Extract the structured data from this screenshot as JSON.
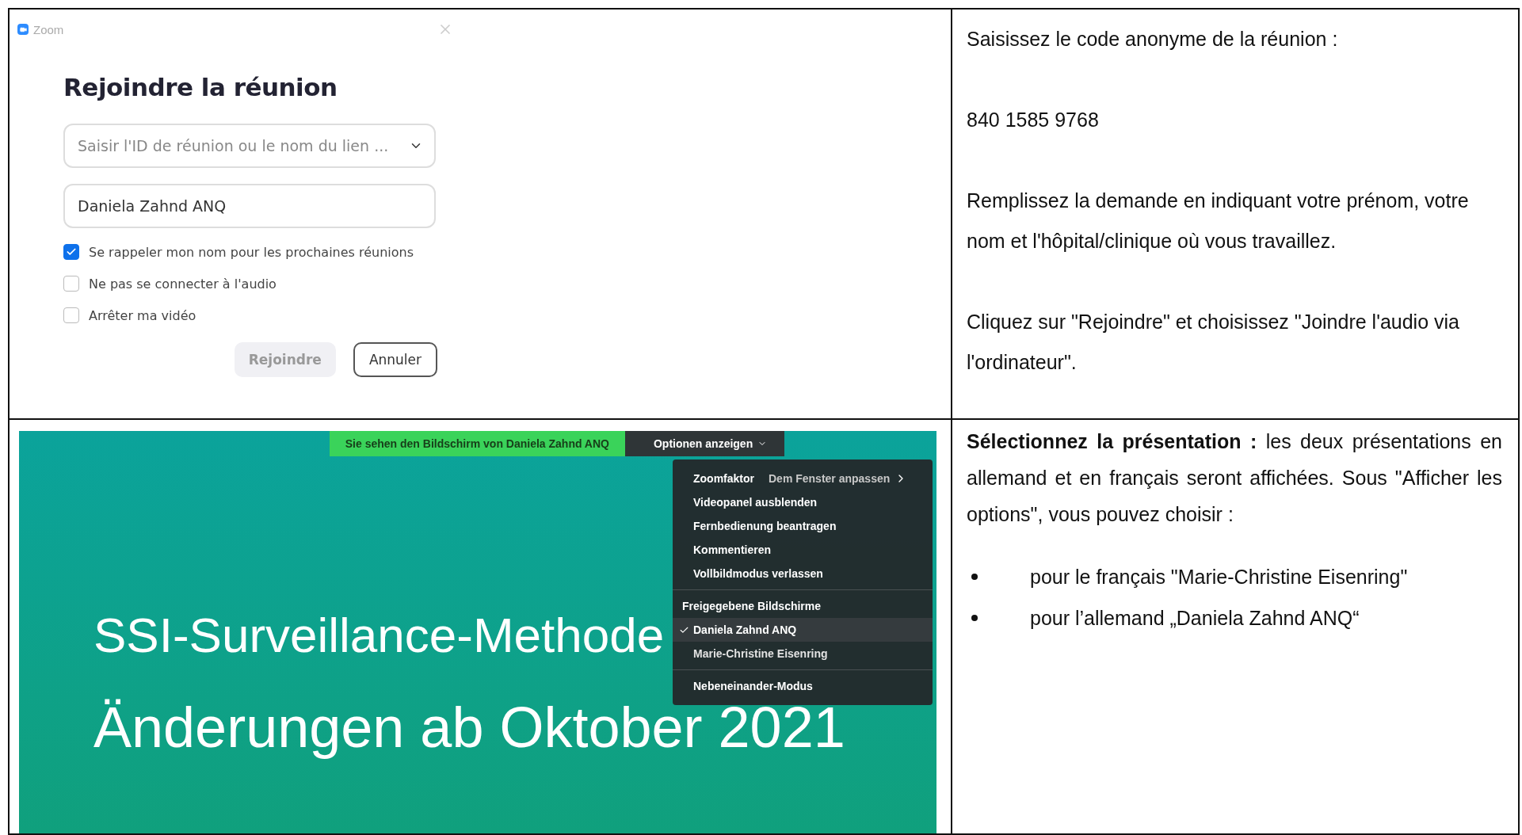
{
  "dialog": {
    "title": "Zoom",
    "heading": "Rejoindre la réunion",
    "meeting_field": {
      "placeholder": "Saisir l'ID de réunion ou le nom du lien ..."
    },
    "name_field": {
      "value": "Daniela Zahnd ANQ"
    },
    "options": [
      {
        "label": "Se rappeler mon nom pour les prochaines réunions",
        "checked": true
      },
      {
        "label": "Ne pas se connecter à l'audio",
        "checked": false
      },
      {
        "label": "Arrêter ma vidéo",
        "checked": false
      }
    ],
    "buttons": [
      {
        "label": "Rejoindre",
        "disabled": true
      },
      {
        "label": "Annuler",
        "disabled": false
      }
    ]
  },
  "instructions_top": [
    "Saisissez le code anonyme de la réunion :",
    "840 1585 9768",
    "Remplissez la demande en indiquant votre prénom, votre nom et l'hôpital/clinique où vous travaillez.",
    "Cliquez sur \"Rejoindre\" et choisissez \"Joindre l'audio via l'ordinateur\"."
  ],
  "shared_screen": {
    "banner": "Sie sehen den Bildschirm von Daniela Zahnd ANQ",
    "options_button": "Optionen anzeigen",
    "menu": [
      {
        "items": [
          {
            "kind": "submenu",
            "label": "Zoomfaktor",
            "value": "Dem Fenster anpassen"
          },
          {
            "kind": "item",
            "label": "Videopanel ausblenden"
          },
          {
            "kind": "item",
            "label": "Fernbedienung beantragen"
          },
          {
            "kind": "item",
            "label": "Kommentieren"
          },
          {
            "kind": "item",
            "label": "Vollbildmodus verlassen"
          }
        ]
      },
      {
        "items": [
          {
            "kind": "header",
            "label": "Freigegebene Bildschirme"
          },
          {
            "kind": "choice",
            "label": "Daniela Zahnd ANQ",
            "selected": true
          },
          {
            "kind": "choice",
            "label": "Marie-Christine Eisenring",
            "selected": false
          }
        ]
      },
      {
        "items": [
          {
            "kind": "item",
            "label": "Nebeneinander-Modus"
          }
        ]
      }
    ],
    "slide_title": [
      "SSI-Surveillance-Methode",
      "Änderungen ab Oktober 2021"
    ]
  },
  "instructions_bottom": {
    "intro": "**Sélectionnez la présentation :** les deux présentations en allemand et en français seront affichées. Sous \"Afficher les options\", vous pouvez choisir :",
    "bullets": [
      "pour le français \"Marie-Christine Eisenring\"",
      "pour l’allemand „Daniela Zahnd ANQ“"
    ]
  }
}
